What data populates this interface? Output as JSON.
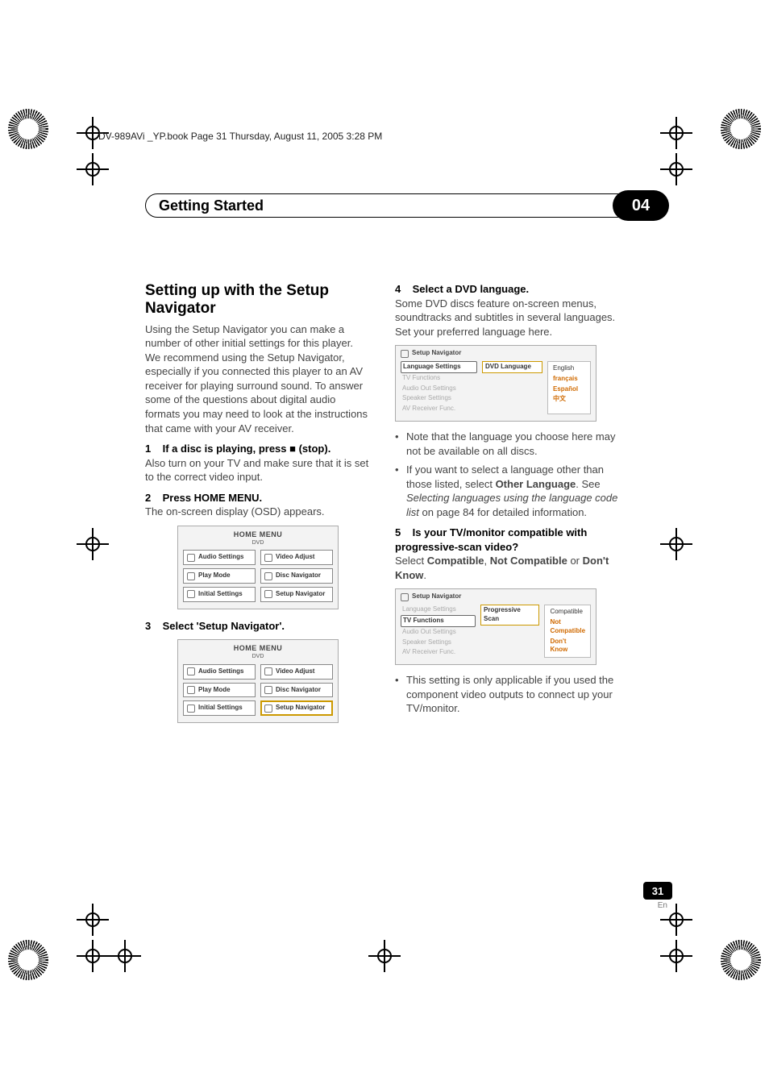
{
  "header_line": "DV-989AVi _YP.book  Page 31  Thursday, August 11, 2005  3:28 PM",
  "chapter": {
    "title": "Getting Started",
    "number": "04"
  },
  "left": {
    "heading": "Setting up with the Setup Navigator",
    "intro": "Using the Setup Navigator you can make a number of other initial settings for this player. We recommend using the Setup Navigator, especially if you connected this player to an AV receiver for playing surround sound. To answer some of the questions about digital audio formats you may need to look at the instructions that came with your AV receiver.",
    "step1_label": "1",
    "step1_title": "If a disc is playing, press ■ (stop).",
    "step1_body": "Also turn on your TV and make sure that it is set to the correct video input.",
    "step2_label": "2",
    "step2_title": "Press HOME MENU.",
    "step2_body": "The on-screen display (OSD) appears.",
    "step3_label": "3",
    "step3_title": "Select 'Setup Navigator'."
  },
  "home_menu": {
    "title": "HOME MENU",
    "subtitle": "DVD",
    "cells": [
      "Audio Settings",
      "Video Adjust",
      "Play Mode",
      "Disc Navigator",
      "Initial Settings",
      "Setup Navigator"
    ]
  },
  "right": {
    "step4_label": "4",
    "step4_title": "Select a DVD language.",
    "step4_body": "Some DVD discs feature on-screen menus, soundtracks and subtitles in several languages. Set your preferred language here.",
    "nav1": {
      "title": "Setup Navigator",
      "left_items": [
        "Language Settings",
        "TV Functions",
        "Audio Out Settings",
        "Speaker Settings",
        "AV Receiver Func."
      ],
      "left_active_index": 0,
      "mid_chip": "DVD Language",
      "right_items": [
        "English",
        "français",
        "Español",
        "中文"
      ],
      "right_hi_from": 1
    },
    "bullet1": "Note that the language you choose here may not be available on all discs.",
    "bullet2_pre": "If you want to select a language other than those listed, select ",
    "bullet2_bold1": "Other Language",
    "bullet2_mid": ". See ",
    "bullet2_italic": "Selecting languages using the language code list",
    "bullet2_post": " on page 84 for detailed information.",
    "step5_label": "5",
    "step5_title": "Is your TV/monitor compatible with progressive-scan video?",
    "step5_body_pre": "Select ",
    "step5_b1": "Compatible",
    "step5_sep1": ", ",
    "step5_b2": "Not Compatible",
    "step5_sep2": " or ",
    "step5_b3": "Don't Know",
    "step5_end": ".",
    "nav2": {
      "title": "Setup Navigator",
      "left_items": [
        "Language Settings",
        "TV Functions",
        "Audio Out Settings",
        "Speaker Settings",
        "AV Receiver Func."
      ],
      "left_active_index": 1,
      "mid_chip": "Progressive Scan",
      "right_items": [
        "Compatible",
        "Not Compatible",
        "Don't Know"
      ],
      "right_hi_from": 1
    },
    "bullet3": "This setting is only applicable if you used the component video outputs to connect up your TV/monitor."
  },
  "footer": {
    "page": "31",
    "lang": "En"
  }
}
